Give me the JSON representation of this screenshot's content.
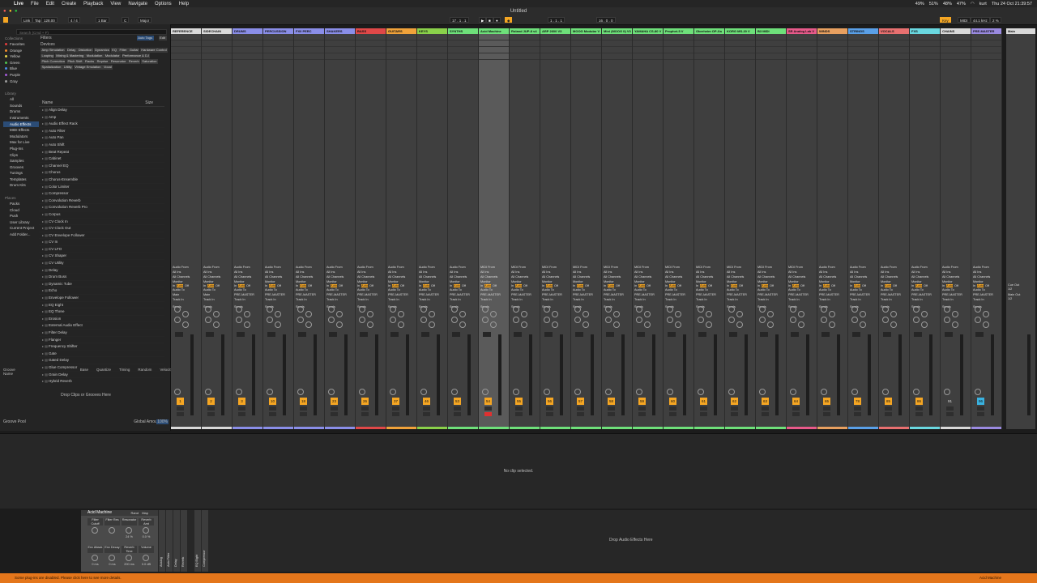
{
  "menubar": {
    "items": [
      "Live",
      "File",
      "Edit",
      "Create",
      "Playback",
      "View",
      "Navigate",
      "Options",
      "Help"
    ],
    "status": [
      "49%",
      "51%",
      "48%",
      "47%",
      "kurt",
      "Thu 24 Oct 21:39:57"
    ]
  },
  "control": {
    "title": "Untitled",
    "link": "Link",
    "tap": "Tap",
    "tempo": "128.00",
    "sig": "4 / 4",
    "bar": "1 Bar",
    "key": "C",
    "scale": "Major",
    "position": "17 . 1 . 1",
    "loop_start": "1 . 1 . 1",
    "loop_len": "16 . 0 . 0",
    "key_label": "Key",
    "midi_label": "MIDI",
    "rate": "44.1 kHz",
    "cpu": "2 %"
  },
  "browser": {
    "search_placeholder": "Search (Cmd + F)",
    "collections_label": "Collections",
    "collections": [
      {
        "name": "Favorites",
        "color": "#e23d3d"
      },
      {
        "name": "Orange",
        "color": "#f08b2a"
      },
      {
        "name": "Yellow",
        "color": "#e6d54a"
      },
      {
        "name": "Green",
        "color": "#4fc24f"
      },
      {
        "name": "Blue",
        "color": "#4a8ce6"
      },
      {
        "name": "Purple",
        "color": "#a35ad6"
      },
      {
        "name": "Gray",
        "color": "#9a9a9a"
      }
    ],
    "library_label": "Library",
    "library": [
      "All",
      "Sounds",
      "Drums",
      "Instruments",
      "Audio Effects",
      "MIDI Effects",
      "Modulators",
      "Max for Live",
      "Plug-Ins",
      "Clips",
      "Samples",
      "Grooves",
      "Tunings",
      "Templates",
      "Drum Kits"
    ],
    "places_label": "Places",
    "places": [
      "Packs",
      "Cloud",
      "Push",
      "User Library",
      "Current Project",
      "Add Folder..."
    ],
    "filters_label": "Filters",
    "auto_tags": "Auto Tags",
    "edit": "Edit",
    "devices_label": "Devices",
    "tags": [
      "Amp Simulation",
      "Delay",
      "Distortion",
      "Dynamics",
      "EQ",
      "Filter",
      "Guitar",
      "Hardware Control",
      "Looping",
      "Mixing & Mastering",
      "Modulation",
      "Modulator",
      "Performance & DJ",
      "Pitch Correction",
      "Pitch Shift",
      "Racks",
      "Reprise",
      "Resonator",
      "Reverb",
      "Saturation",
      "Spatialization",
      "Utility",
      "Vintage Emulation",
      "Vocal"
    ],
    "col_name": "Name",
    "col_size": "Size",
    "items": [
      "Align Delay",
      "Amp",
      "Audio Effect Rack",
      "Auto Filter",
      "Auto Pan",
      "Auto Shift",
      "Beat Repeat",
      "Cabinet",
      "Channel EQ",
      "Chorus",
      "Chorus-Ensemble",
      "Color Limiter",
      "Compressor",
      "Convolution Reverb",
      "Convolution Reverb Pro",
      "Corpus",
      "CV Clock In",
      "CV Clock Out",
      "CV Envelope Follower",
      "CV In",
      "CV LFO",
      "CV Shaper",
      "CV Utility",
      "Delay",
      "Drum Buss",
      "Dynamic Tube",
      "Echo",
      "Envelope Follower",
      "EQ Eight",
      "EQ Three",
      "Erosion",
      "External Audio Effect",
      "Filter Delay",
      "Flanger",
      "Frequency Shifter",
      "Gate",
      "Gated Delay",
      "Glue Compressor",
      "Grain Delay",
      "Hybrid Reverb",
      "IR Measurement Device",
      "LFO",
      "Limiter",
      "Looper",
      "Multiband Dynamics"
    ],
    "groove_cols": [
      "Groove Name",
      "Base",
      "Quantize",
      "Timing",
      "Random",
      "Velocity"
    ],
    "groove_drop": "Drop Clips or Grooves Here",
    "groove_pool": "Groove Pool",
    "global_amount": "Global Amount",
    "global_value": "100%"
  },
  "tracks": [
    {
      "name": "REFERENCE",
      "color": "#d9d9d9",
      "num": "1"
    },
    {
      "name": "SIDECHAIN",
      "color": "#d9d9d9",
      "num": "2"
    },
    {
      "name": "DRUMS",
      "color": "#8a8ee8",
      "num": "3"
    },
    {
      "name": "PERCUSSION",
      "color": "#8a8ee8",
      "num": "10"
    },
    {
      "name": "FX0 PERC",
      "color": "#8a8ee8",
      "num": "18"
    },
    {
      "name": "SHAKERS",
      "color": "#8a8ee8",
      "num": "23"
    },
    {
      "name": "BASS",
      "color": "#e04848",
      "num": "26"
    },
    {
      "name": "GUITARS",
      "color": "#f0a23a",
      "num": "37"
    },
    {
      "name": "KEYS",
      "color": "#8ad14a",
      "num": "46"
    },
    {
      "name": "SYNTHS",
      "color": "#6ee07a",
      "num": "53"
    },
    {
      "name": "Acid Machine",
      "color": "#6ee07a",
      "num": "54"
    },
    {
      "name": "Roland JUP-8 v4",
      "color": "#6ee07a",
      "num": "55"
    },
    {
      "name": "ARP 2600 V3",
      "color": "#6ee07a",
      "num": "56"
    },
    {
      "name": "MOOG Modular V",
      "color": "#6ee07a",
      "num": "57"
    },
    {
      "name": "Mini (MOOG II) V3",
      "color": "#6ee07a",
      "num": "58"
    },
    {
      "name": "YAMAHA CS-80 V",
      "color": "#6ee07a",
      "num": "59"
    },
    {
      "name": "Prophet-5 V",
      "color": "#6ee07a",
      "num": "60"
    },
    {
      "name": "Oberheim OP-Xa",
      "color": "#6ee07a",
      "num": "61"
    },
    {
      "name": "KORG MS-20 V",
      "color": "#6ee07a",
      "num": "62"
    },
    {
      "name": "B3 MIDI",
      "color": "#6ee07a",
      "num": "63"
    },
    {
      "name": "SR Analog Lab V",
      "color": "#e85a8a",
      "num": "64"
    },
    {
      "name": "WINDS",
      "color": "#e8a060",
      "num": "65"
    },
    {
      "name": "STRINGS",
      "color": "#5aa0e8",
      "num": "78"
    },
    {
      "name": "VOCALS",
      "color": "#e87070",
      "num": "85"
    },
    {
      "name": "FXS",
      "color": "#6ad8e0",
      "num": "86"
    },
    {
      "name": "CHAINS",
      "color": "#d9d9d9",
      "num": "91"
    },
    {
      "name": "PRE-MASTER",
      "color": "#9a8ae0",
      "num": "96"
    }
  ],
  "master": {
    "name": "Main",
    "cue_out": "Cue Out",
    "cue_val": "1/2",
    "main_out": "Main Out",
    "main_val": "1/2"
  },
  "io": {
    "audio_from": "Audio From",
    "midi_from": "MIDI From",
    "all_ins": "All Ins",
    "all_channels": "All Channels",
    "monitor": "Monitor",
    "in": "In",
    "auto": "Auto",
    "off": "Off",
    "audio_to": "Audio To",
    "pre_master": "PRE-MASTER",
    "main": "Main",
    "sends": "Sends",
    "track_in": "Track In"
  },
  "clip": {
    "no_selection": "No clip selected."
  },
  "device": {
    "rack_name": "Acid Machine",
    "rand": "Rand",
    "map": "Map",
    "macros": [
      "Filter Cutoff",
      "Filter Res",
      "Resonator",
      "Reverb Amt",
      "Env Attack",
      "Env Decay",
      "Reverb Time",
      "Volume"
    ],
    "macro_vals": [
      "",
      "",
      "24 %",
      "0.0 %",
      "0 ms",
      "0 ms",
      "200 ms",
      "0.0 dB"
    ],
    "chain": [
      "Analog",
      "Auto Filter",
      "Delay",
      "Reverb",
      "EQ Eight",
      "Compressor"
    ],
    "drop_fx": "Drop Audio Effects Here"
  },
  "status": {
    "message": "Some plug-ins are disabled. Please click here to see more details.",
    "right": "Acid Machine"
  }
}
